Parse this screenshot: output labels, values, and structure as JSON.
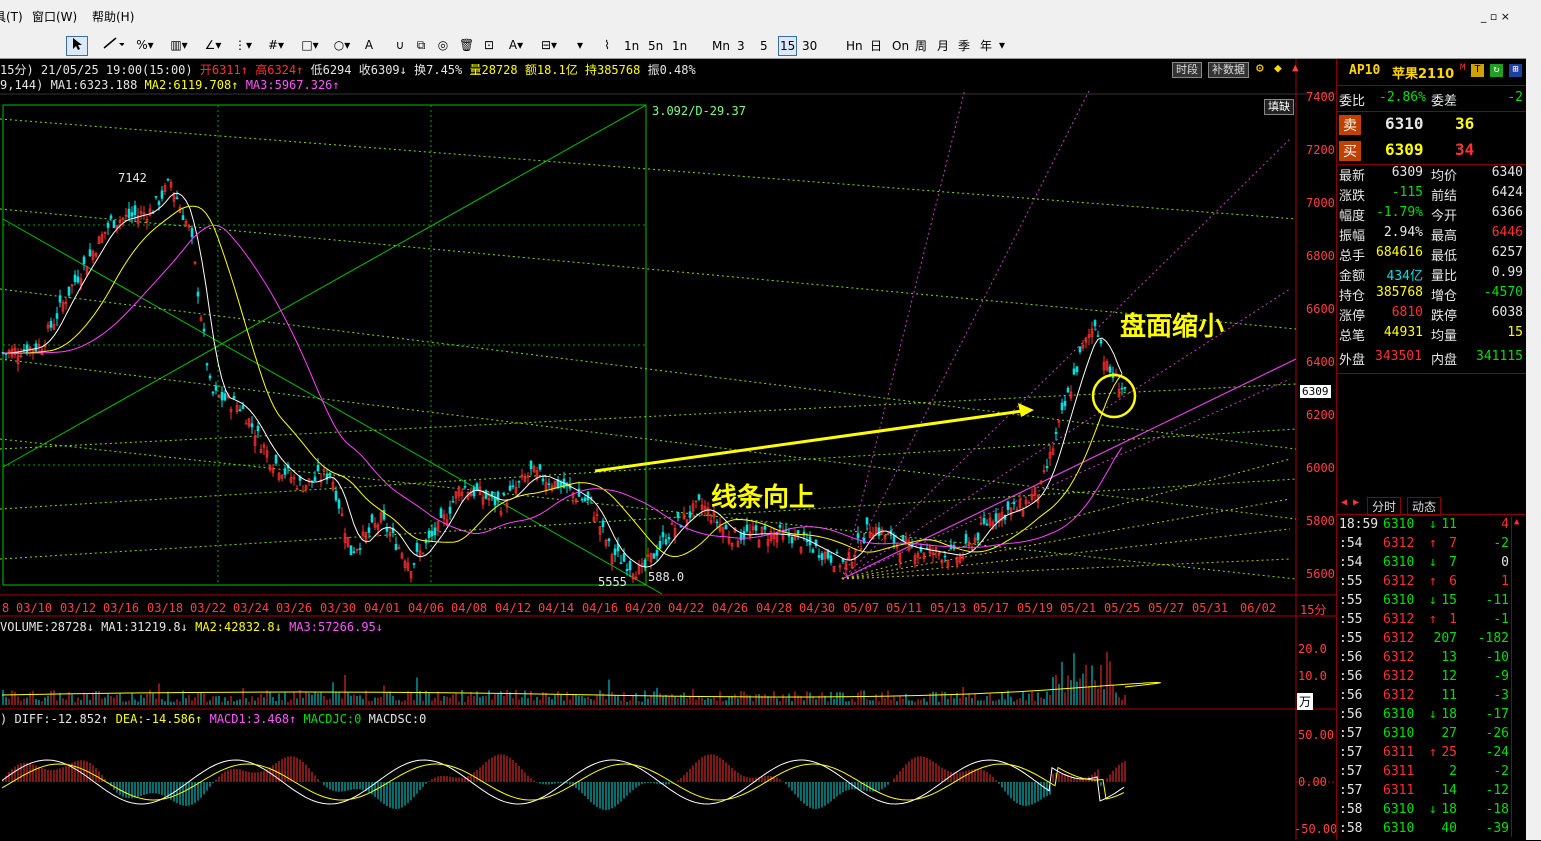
{
  "menu": {
    "items": [
      {
        "label": "具(T)",
        "x": -6
      },
      {
        "label": "窗口(W)",
        "x": 32
      },
      {
        "label": "帮助(H)",
        "x": 92
      }
    ]
  },
  "toolbar": {
    "periods": [
      "1n",
      "5n",
      "1n",
      "Mn",
      "3",
      "5",
      "15",
      "30",
      "Hn",
      "日",
      "On",
      "周",
      "月",
      "季",
      "年"
    ],
    "active_period": "15"
  },
  "window_controls": "_ ▫ ×",
  "quote_line": {
    "prefix": "15分) 21/05/25 19:00(15:00)",
    "open": "开6311",
    "high": "高6324",
    "low": "低6294",
    "close": "收6309",
    "turnover": "换7.45%",
    "volume": "量28728",
    "amount": "额18.1亿",
    "oi": "持385768",
    "amplitude": "振0.48%"
  },
  "ma_line": {
    "params": "9,144)",
    "ma1": "MA1:6323.188",
    "ma2": "MA2:6119.708",
    "ma3": "MA3:5967.326"
  },
  "buttons": {
    "time": "时段",
    "fill": "补数据",
    "fill_gap": "填缺"
  },
  "price_axis": {
    "labels": [
      "7400",
      "7200",
      "7000",
      "6800",
      "6600",
      "6400",
      "6200",
      "6000",
      "5800",
      "5600"
    ],
    "current": "6309"
  },
  "date_axis": {
    "labels": [
      "8",
      "03/10",
      "03/12",
      "03/16",
      "03/18",
      "03/22",
      "03/24",
      "03/26",
      "03/30",
      "04/01",
      "04/06",
      "04/08",
      "04/12",
      "04/14",
      "04/16",
      "04/20",
      "04/22",
      "04/26",
      "04/28",
      "04/30",
      "05/07",
      "05/11",
      "05/13",
      "05/17",
      "05/19",
      "05/21",
      "05/25",
      "05/27",
      "05/31",
      "06/02"
    ],
    "unit": "15分"
  },
  "chart_labels": {
    "high_mark": "7142",
    "low_mark": "5555",
    "low_mark2": "588.0",
    "gann_label": "3.092/D-29.37"
  },
  "annotations": {
    "up_lines": "线条向上",
    "shrink": "盘面缩小"
  },
  "volume_panel": {
    "title": "VOLUME:28728",
    "ma1": "MA1:31219.8",
    "ma2": "MA2:42832.8",
    "ma3": "MA3:57266.95",
    "axis": [
      "20.0",
      "10.0"
    ],
    "unit": "万"
  },
  "macd_panel": {
    "diff": "DIFF:-12.852",
    "dea": "DEA:-14.586",
    "macd1": "MACD1:3.468",
    "macdjc": "MACDJC:0",
    "macdsc": "MACDSC:0",
    "axis": [
      "50.00",
      "0.00",
      "-50.00"
    ]
  },
  "instrument": {
    "code": "AP10",
    "name": "苹果2110"
  },
  "side": {
    "weibi_label": "委比",
    "weibi": "-2.86%",
    "weicha_label": "委差",
    "weicha": "-2",
    "sell_label": "卖",
    "sell_price": "6310",
    "sell_qty": "36",
    "buy_label": "买",
    "buy_price": "6309",
    "buy_qty": "34",
    "stats": [
      [
        "最新",
        "6309",
        "均价",
        "6340"
      ],
      [
        "涨跌",
        "-115",
        "前结",
        "6424"
      ],
      [
        "幅度",
        "-1.79%",
        "今开",
        "6366"
      ],
      [
        "振幅",
        "2.94%",
        "最高",
        "6446"
      ],
      [
        "总手",
        "684616",
        "最低",
        "6257"
      ],
      [
        "金额",
        "434亿",
        "量比",
        "0.99"
      ],
      [
        "持仓",
        "385768",
        "增仓",
        "-4570"
      ],
      [
        "涨停",
        "6810",
        "跌停",
        "6038"
      ],
      [
        "总笔",
        "44931",
        "均量",
        "15"
      ]
    ],
    "outer_label": "外盘",
    "outer": "343501",
    "inner_label": "内盘",
    "inner": "341115",
    "tabs": [
      "分时",
      "动态"
    ]
  },
  "ticks": [
    [
      "18:59",
      "6310",
      "↓",
      "11",
      "4"
    ],
    [
      ":54",
      "6312",
      "↑",
      "7",
      "-2"
    ],
    [
      ":54",
      "6310",
      "↓",
      "7",
      "0"
    ],
    [
      ":55",
      "6312",
      "↑",
      "6",
      "1"
    ],
    [
      ":55",
      "6310",
      "↓",
      "15",
      "-11"
    ],
    [
      ":55",
      "6312",
      "↑",
      "1",
      "-1"
    ],
    [
      ":55",
      "6312",
      "",
      "207",
      "-182"
    ],
    [
      ":56",
      "6312",
      "",
      "13",
      "-10"
    ],
    [
      ":56",
      "6312",
      "",
      "12",
      "-9"
    ],
    [
      ":56",
      "6312",
      "",
      "11",
      "-3"
    ],
    [
      ":56",
      "6310",
      "↓",
      "18",
      "-17"
    ],
    [
      ":57",
      "6310",
      "",
      "27",
      "-26"
    ],
    [
      ":57",
      "6311",
      "↑",
      "25",
      "-24"
    ],
    [
      ":57",
      "6311",
      "",
      "2",
      "-2"
    ],
    [
      ":57",
      "6311",
      "",
      "14",
      "-12"
    ],
    [
      ":58",
      "6310",
      "↓",
      "18",
      "-18"
    ],
    [
      ":58",
      "6310",
      "",
      "40",
      "-39"
    ]
  ]
}
